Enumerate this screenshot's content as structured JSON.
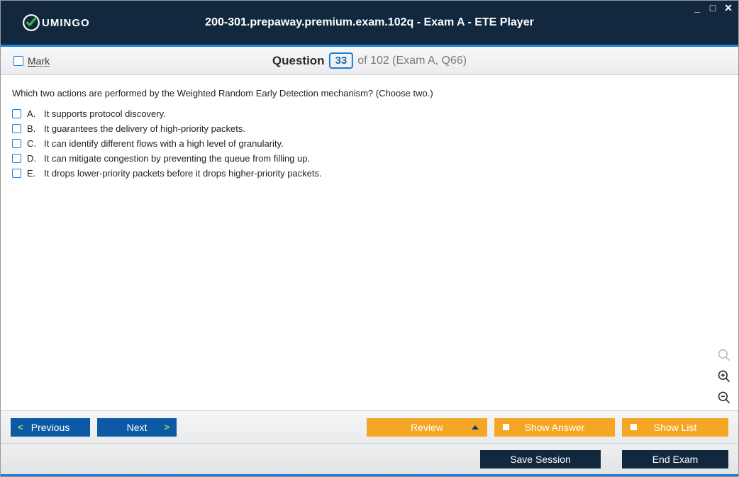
{
  "window": {
    "title": "200-301.prepaway.premium.exam.102q - Exam A - ETE Player",
    "logo_text": "UMINGO"
  },
  "subbar": {
    "mark_label": "Mark",
    "q_label": "Question",
    "q_number": "33",
    "q_rest": "of 102 (Exam A, Q66)"
  },
  "question": {
    "text": "Which two actions are performed by the Weighted Random Early Detection mechanism? (Choose two.)",
    "options": [
      {
        "letter": "A.",
        "text": "It supports protocol discovery."
      },
      {
        "letter": "B.",
        "text": "It guarantees the delivery of high-priority packets."
      },
      {
        "letter": "C.",
        "text": "It can identify different flows with a high level of granularity."
      },
      {
        "letter": "D.",
        "text": "It can mitigate congestion by preventing the queue from filling up."
      },
      {
        "letter": "E.",
        "text": "It drops lower-priority packets before it drops higher-priority packets."
      }
    ]
  },
  "footer": {
    "previous": "Previous",
    "next": "Next",
    "review": "Review",
    "show_answer": "Show Answer",
    "show_list": "Show List",
    "save_session": "Save Session",
    "end_exam": "End Exam"
  }
}
